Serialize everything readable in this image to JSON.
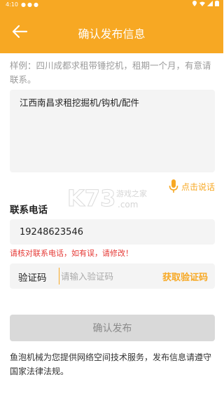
{
  "statusbar": {
    "time": "4:10",
    "dots": "●●●"
  },
  "appbar": {
    "title": "确认发布信息"
  },
  "form": {
    "hint": "样例：四川成都求租带锤挖机，租期一个月，有意请联系。",
    "content": "江西南昌求租挖掘机/钩机/配件",
    "voice_label": "点击说话",
    "contact_label": "联系电话",
    "phone": "19248623546",
    "warning": "请核对联系电话，如有误，请修改！",
    "code_label": "验证码",
    "code_placeholder": "请输入验证码",
    "get_code": "获取验证码",
    "submit": "确认发布",
    "footer": "鱼泡机械为您提供网络空间技术服务，发布信息请遵守国家法律法规。"
  },
  "watermark": {
    "text": "K73",
    "sub": "游戏之家",
    "domain": ".com"
  },
  "colors": {
    "accent": "#f7a823",
    "warning": "#e53935",
    "disabled": "#d9d9d9"
  }
}
